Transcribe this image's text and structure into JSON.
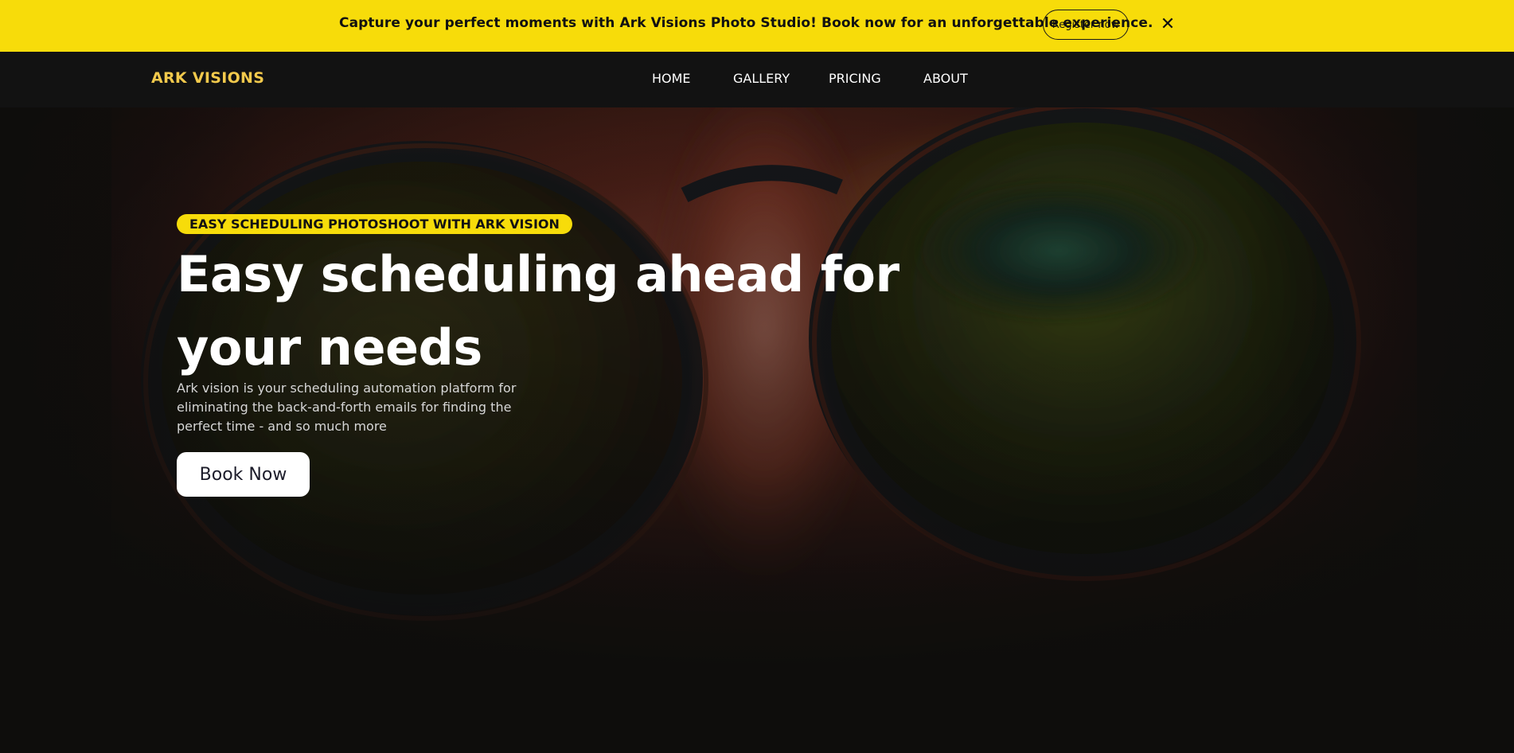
{
  "announcement": {
    "text": "Capture your perfect moments with Ark Visions Photo Studio! Book now for an unforgettable experience.",
    "register_label": "Register now",
    "close_icon": "close-icon",
    "close_glyph": "✕",
    "background_color": "#f7dc0a"
  },
  "navbar": {
    "logo": "ARK VISIONS",
    "logo_color": "#f2c94c",
    "items": [
      {
        "label": "HOME"
      },
      {
        "label": "GALLERY"
      },
      {
        "label": "PRICING"
      },
      {
        "label": "ABOUT"
      }
    ]
  },
  "hero": {
    "tag": "EASY SCHEDULING PHOTOSHOOT WITH ARK VISION",
    "title": "Easy scheduling ahead for your needs",
    "description": "Ark vision is your scheduling automation platform for eliminating the back-and-forth emails for finding the perfect time - and so much more",
    "cta_label": "Book Now",
    "background_image": "close-up-face-with-glasses-photo",
    "accent_color": "#f7dc0a"
  }
}
